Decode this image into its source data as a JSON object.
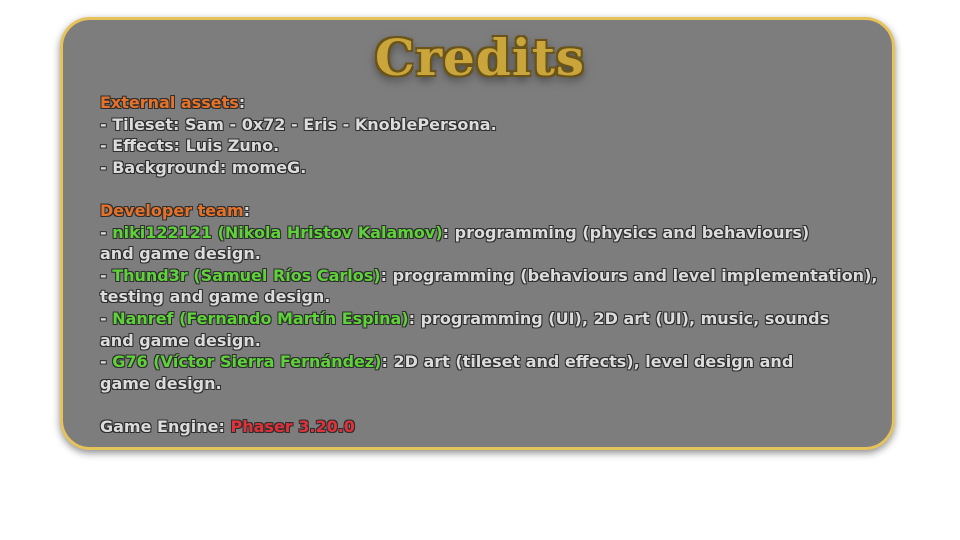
{
  "title": "Credits",
  "colors": {
    "panel_bg": "#7d7d7d",
    "panel_border": "#e6c25a",
    "heading": "#e5722a",
    "name": "#5fd13a",
    "engine": "#e0323a",
    "text": "#dcdcdc"
  },
  "external_assets": {
    "heading": "External assets",
    "colon": ":",
    "items": [
      "- Tileset: Sam - 0x72 - Eris - KnoblePersona.",
      "- Effects: Luis Zuno.",
      "- Background: momeG."
    ]
  },
  "developer_team": {
    "heading": "Developer team",
    "colon": ":",
    "members": [
      {
        "prefix": "- ",
        "name": "niki122121 (Nikola Hristov Kalamov)",
        "role_line1": ": programming (physics and behaviours)",
        "role_line2": "and game design."
      },
      {
        "prefix": "- ",
        "name": "Thund3r (Samuel Ríos Carlos)",
        "role_line1": ": programming (behaviours and level implementation),",
        "role_line2": "testing and game design."
      },
      {
        "prefix": "- ",
        "name": "Nanref (Fernando Martín Espina)",
        "role_line1": ": programming (UI), 2D art (UI), music, sounds",
        "role_line2": "and game design."
      },
      {
        "prefix": "- ",
        "name": "G76 (Víctor Sierra Fernández)",
        "role_line1": ": 2D art (tileset and effects), level design and",
        "role_line2": "game design."
      }
    ]
  },
  "engine": {
    "label": "Game Engine: ",
    "value": "Phaser 3.20.0"
  }
}
